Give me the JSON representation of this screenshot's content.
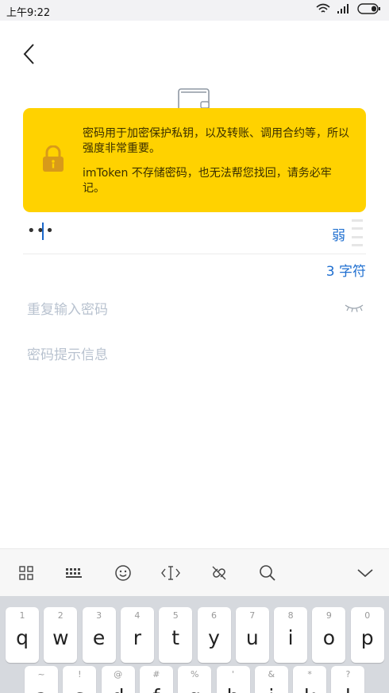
{
  "status_bar": {
    "time": "上午9:22"
  },
  "tooltip": {
    "line1": "密码用于加密保护私钥，以及转账、调用合约等，所以强度非常重要。",
    "line2": "imToken 不存储密码，也无法帮您找回，请务必牢记。"
  },
  "password": {
    "value": "•••",
    "strength": "弱",
    "char_count": "3 字符"
  },
  "repeat": {
    "placeholder": "重复输入密码"
  },
  "hint": {
    "placeholder": "密码提示信息"
  },
  "keyboard": {
    "row1": [
      {
        "sub": "1",
        "main": "q"
      },
      {
        "sub": "2",
        "main": "w"
      },
      {
        "sub": "3",
        "main": "e"
      },
      {
        "sub": "4",
        "main": "r"
      },
      {
        "sub": "5",
        "main": "t"
      },
      {
        "sub": "6",
        "main": "y"
      },
      {
        "sub": "7",
        "main": "u"
      },
      {
        "sub": "8",
        "main": "i"
      },
      {
        "sub": "9",
        "main": "o"
      },
      {
        "sub": "0",
        "main": "p"
      }
    ],
    "row2": [
      {
        "sub": "~",
        "main": "a"
      },
      {
        "sub": "!",
        "main": "s"
      },
      {
        "sub": "@",
        "main": "d"
      },
      {
        "sub": "#",
        "main": "f"
      },
      {
        "sub": "%",
        "main": "g"
      },
      {
        "sub": "'",
        "main": "h"
      },
      {
        "sub": "&",
        "main": "j"
      },
      {
        "sub": "*",
        "main": "k"
      },
      {
        "sub": "?",
        "main": "l"
      }
    ]
  },
  "colors": {
    "accent": "#1f6fd0",
    "tooltip": "#ffd200",
    "lock": "#d89a1a"
  },
  "icons": [
    "back-arrow-icon",
    "wallet-icon",
    "lock-icon",
    "eye-closed-icon",
    "grid-icon",
    "keyboard-icon",
    "emoji-icon",
    "cursor-icon",
    "link-icon",
    "search-icon",
    "collapse-icon"
  ]
}
